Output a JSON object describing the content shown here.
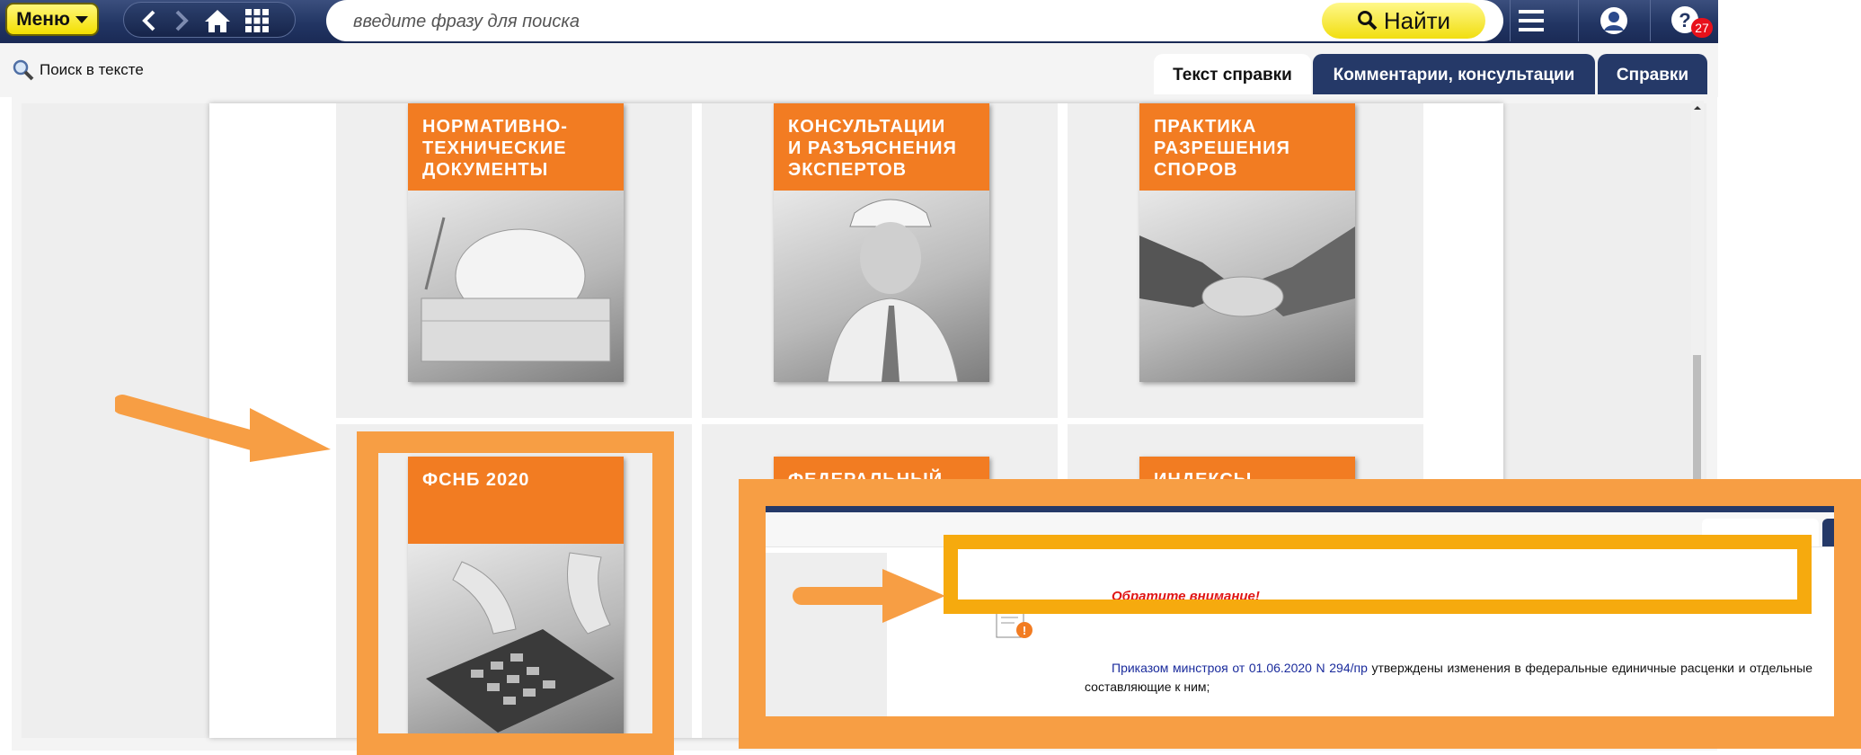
{
  "toolbar": {
    "menu_label": "Меню",
    "search_placeholder": "введите фразу для поиска",
    "find_label": "Найти",
    "notifications_count": "27"
  },
  "secondary": {
    "find_in_text": "Поиск в тексте"
  },
  "tabs": [
    {
      "label": "Текст справки",
      "active": true
    },
    {
      "label": "Комментарии, консультации",
      "active": false
    },
    {
      "label": "Справки",
      "active": false
    }
  ],
  "cards": [
    {
      "title": "НОРМАТИВНО-\nТЕХНИЧЕСКИЕ\nДОКУМЕНТЫ"
    },
    {
      "title": "КОНСУЛЬТАЦИИ\nИ РАЗЪЯСНЕНИЯ\nЭКСПЕРТОВ"
    },
    {
      "title": "ПРАКТИКА\nРАЗРЕШЕНИЯ\nСПОРОВ"
    },
    {
      "title": "ФСНБ 2020"
    },
    {
      "title": "ФЕДЕРАЛЬНЫЙ"
    },
    {
      "title": "ИНДЕКСЫ"
    }
  ],
  "inset": {
    "notice": "Обратите внимание!",
    "paragraph_link": "Приказом минстроя от 01.06.2020 N 294/пр",
    "paragraph_rest": " утверждены изменения в федеральные единичные расценки и отдельные составляющие к ним;"
  },
  "colors": {
    "toolbar": "#223563",
    "accent_yellow": "#f3df00",
    "card_orange": "#f27c22",
    "annotation_orange": "#f79e44",
    "notice_red": "#e01515"
  }
}
